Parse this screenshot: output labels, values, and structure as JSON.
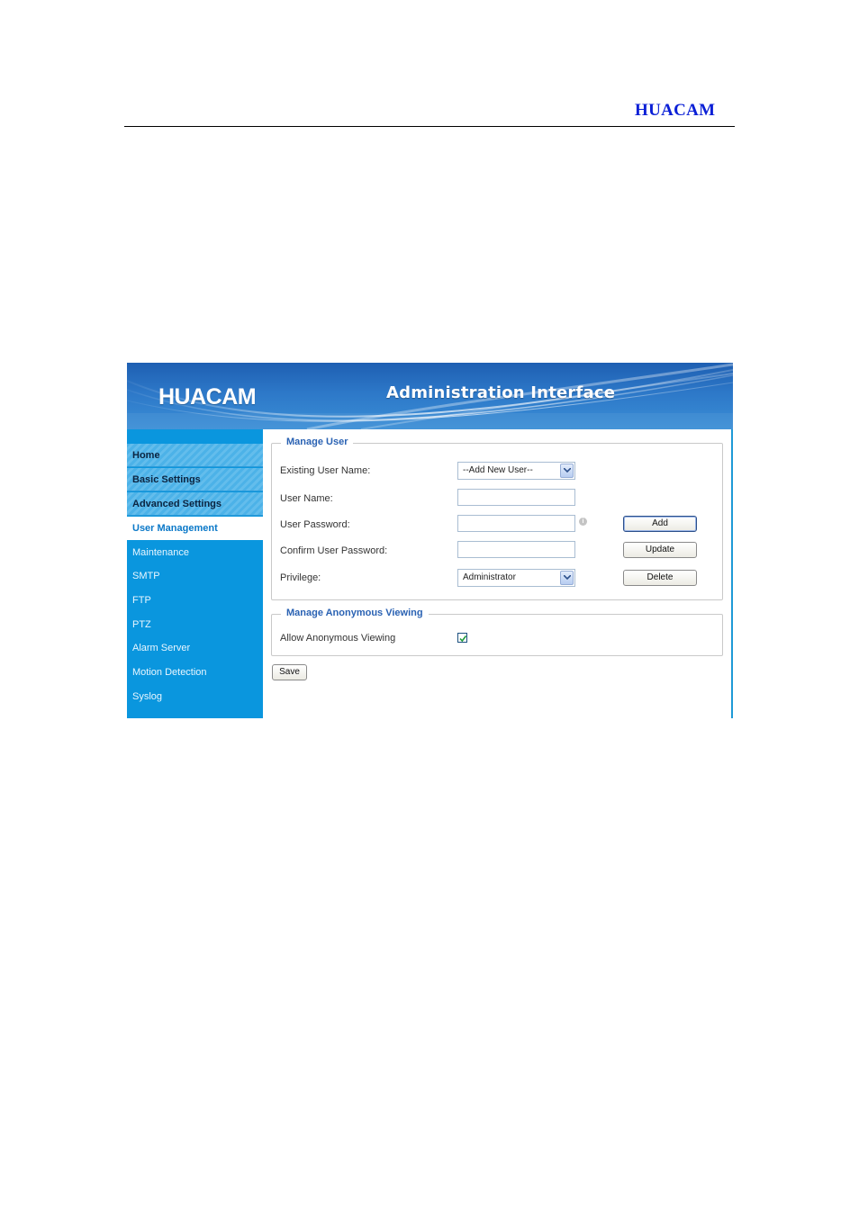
{
  "document": {
    "brand": "HUACAM"
  },
  "banner": {
    "logo": "HUACAM",
    "title": "Administration Interface"
  },
  "sidebar": {
    "items": [
      {
        "label": "Home"
      },
      {
        "label": "Basic Settings"
      },
      {
        "label": "Advanced Settings"
      },
      {
        "label": "User Management"
      },
      {
        "label": "Maintenance"
      },
      {
        "label": "SMTP"
      },
      {
        "label": "FTP"
      },
      {
        "label": "PTZ"
      },
      {
        "label": "Alarm Server"
      },
      {
        "label": "Motion Detection"
      },
      {
        "label": "Syslog"
      }
    ],
    "active": "User Management"
  },
  "manage_user": {
    "legend": "Manage User",
    "existing_user_label": "Existing User Name:",
    "existing_user_value": "--Add New User--",
    "user_name_label": "User Name:",
    "user_name_value": "",
    "user_password_label": "User Password:",
    "user_password_value": "",
    "confirm_password_label": "Confirm User Password:",
    "confirm_password_value": "",
    "privilege_label": "Privilege:",
    "privilege_value": "Administrator",
    "add_label": "Add",
    "update_label": "Update",
    "delete_label": "Delete"
  },
  "anonymous": {
    "legend": "Manage Anonymous Viewing",
    "allow_label": "Allow Anonymous Viewing",
    "allow_checked": true
  },
  "save_label": "Save",
  "colors": {
    "brand_blue": "#0a1fd6",
    "sidebar": "#0a96de",
    "legend": "#2a62b3"
  }
}
